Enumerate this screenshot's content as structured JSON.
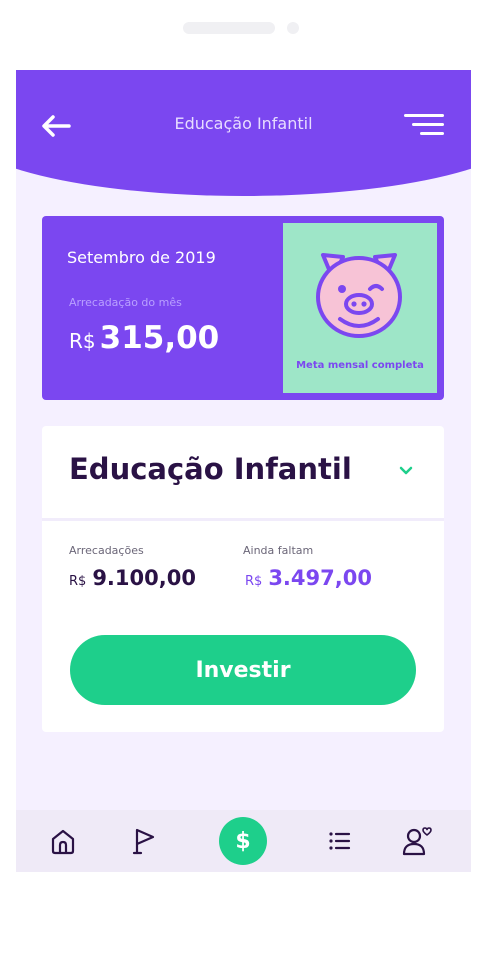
{
  "header": {
    "title": "Educação Infantil",
    "back_icon": "arrow-left-icon",
    "menu_icon": "menu-icon",
    "color": "#7b47f0"
  },
  "summary": {
    "month": "Setembro de 2019",
    "collected_label": "Arrecadação do mês",
    "currency": "R$",
    "amount": "315,00",
    "goal_text": "Meta mensal completa",
    "goal_icon": "piggy-bank-icon",
    "goal_color": "#9ee6c8"
  },
  "fund": {
    "title": "Educação Infantil",
    "dropdown_icon": "chevron-down-icon",
    "collected_label": "Arrecadações",
    "collected_currency": "R$",
    "collected_value": "9.100,00",
    "remaining_label": "Ainda faltam",
    "remaining_currency": "R$",
    "remaining_value": "3.497,00",
    "invest_label": "Investir",
    "accent": "#1ecf8b"
  },
  "tabbar": {
    "items": [
      {
        "icon": "home-icon"
      },
      {
        "icon": "flag-icon"
      },
      {
        "icon": "dollar-icon",
        "glyph": "$",
        "active": true
      },
      {
        "icon": "list-icon"
      },
      {
        "icon": "profile-heart-icon"
      }
    ]
  }
}
